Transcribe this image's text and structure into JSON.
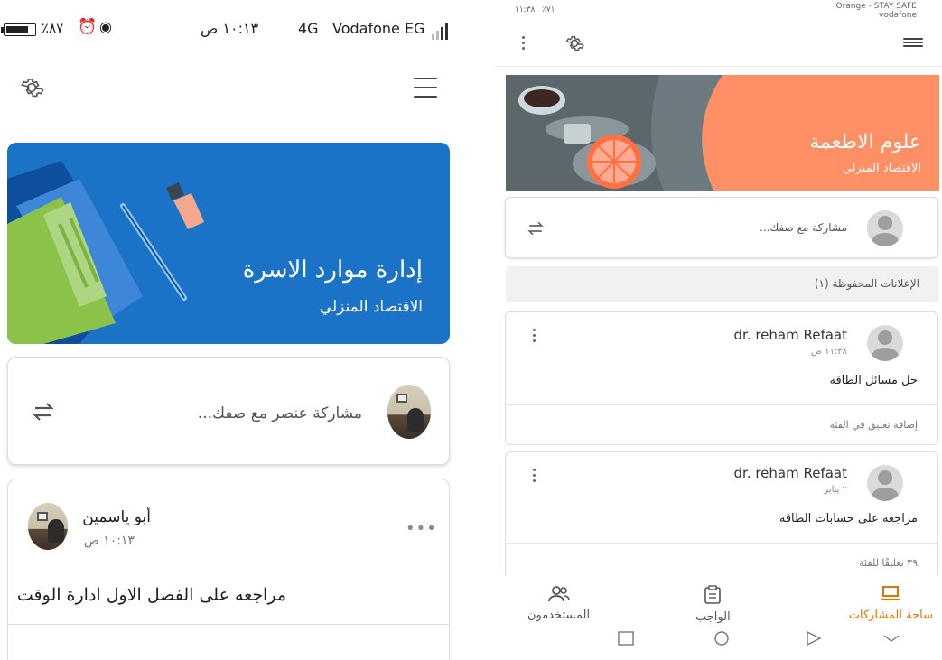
{
  "left_phone": {
    "status": {
      "battery_text": "٪٨٧",
      "time": "١٠:١٣ ص",
      "network": "4G",
      "carrier": "Vodafone EG"
    },
    "banner": {
      "title": "إدارة موارد الاسرة",
      "subtitle": "الاقتصاد المنزلي",
      "color": "#1a73c7"
    },
    "share": {
      "placeholder": "مشاركة عنصر مع صفك..."
    },
    "post": {
      "author": "أبو ياسمين",
      "time": "١٠:١٣ ص",
      "body": "مراجعه على الفصل الاول ادارة الوقت"
    }
  },
  "right_phone": {
    "status": {
      "time": "١١:٣٨",
      "battery_text": "٪٧١",
      "carrier_line1": "Orange - STAY SAFE",
      "carrier_line2": "vodafone"
    },
    "banner": {
      "title": "علوم الاطعمة",
      "subtitle": "الاقتصاد المنزلي",
      "color": "#ff8f64"
    },
    "share": {
      "placeholder": "مشاركة مع صفك..."
    },
    "saved_announcements": "الإعلانات المحفوظة (١)",
    "posts": [
      {
        "author": "dr. reham Refaat",
        "time": "١١:٣٨ ص",
        "body": "حل مسائل الطاقه",
        "comment": "إضافة تعليق في الفئة"
      },
      {
        "author": "dr. reham Refaat",
        "time": "٢ يناير",
        "body": "مراجعه على حسابات الطاقه",
        "comment": "٣٩ تعليقًا للفئة"
      }
    ],
    "bottom_nav": [
      {
        "label": "ساحة المشاركات",
        "icon": "stream-icon",
        "active": true
      },
      {
        "label": "الواجب",
        "icon": "classwork-icon",
        "active": false
      },
      {
        "label": "المستخدمون",
        "icon": "people-icon",
        "active": false
      }
    ],
    "accent": "#e37400"
  }
}
